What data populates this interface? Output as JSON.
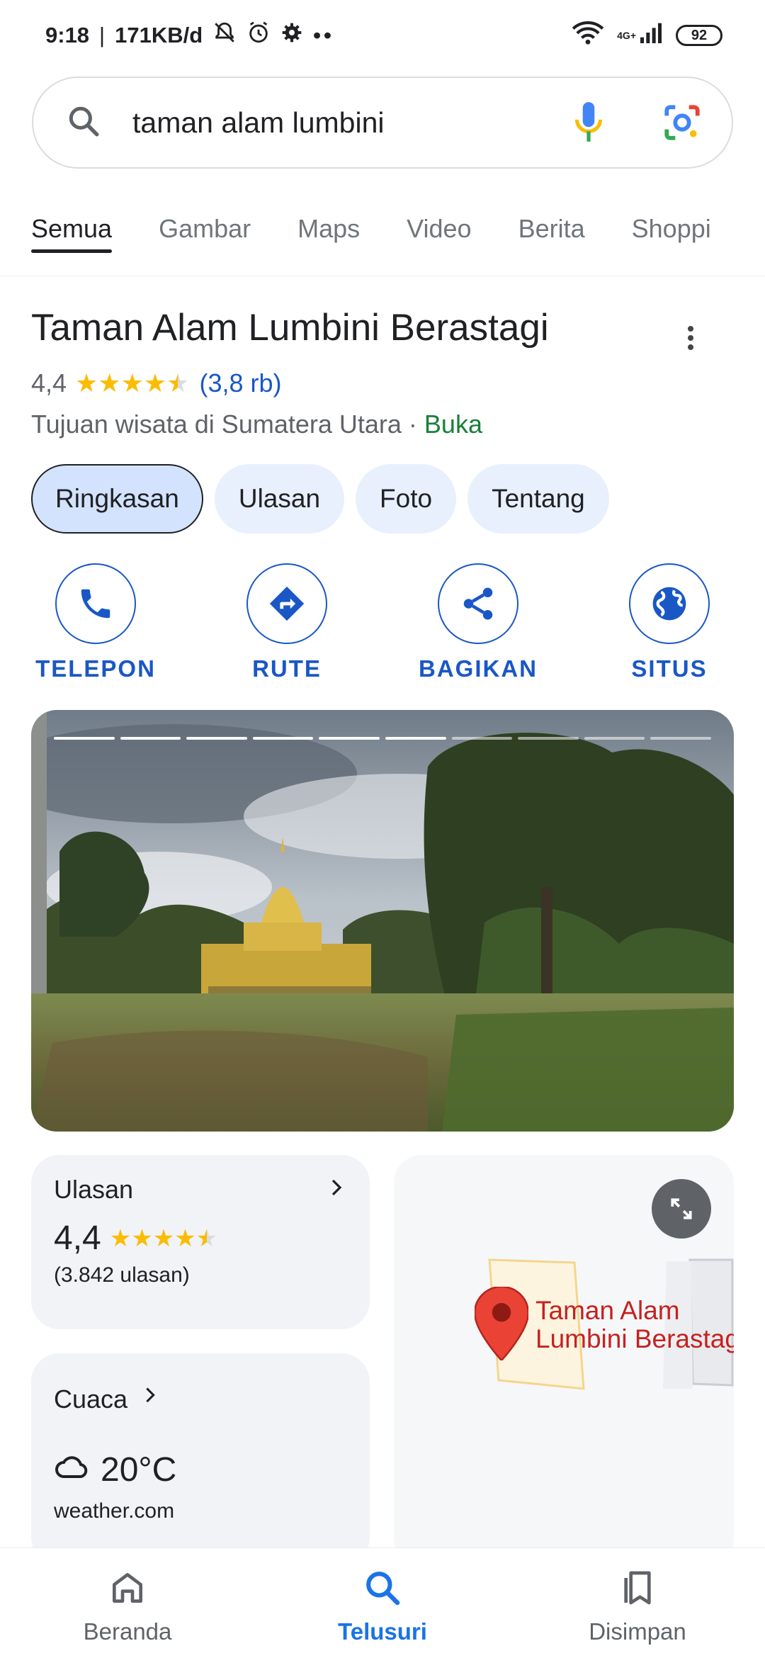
{
  "status_bar": {
    "time": "9:18",
    "speed": "171KB/d",
    "network_label": "4G+",
    "battery": "92",
    "icons": [
      "mute-bell-icon",
      "alarm-icon",
      "gear-icon",
      "more-dots-icon",
      "wifi-icon",
      "signal-icon"
    ]
  },
  "search": {
    "query": "taman alam lumbini",
    "icons": [
      "search-icon",
      "mic-icon",
      "lens-icon"
    ]
  },
  "tabs": [
    "Semua",
    "Gambar",
    "Maps",
    "Video",
    "Berita",
    "Shoppi"
  ],
  "active_tab": "Semua",
  "place": {
    "title": "Taman Alam Lumbini Berastagi",
    "rating": "4,4",
    "rating_value": 4.4,
    "review_count": "(3,8 rb)",
    "category": "Tujuan wisata di Sumatera Utara",
    "separator": " · ",
    "status": "Buka",
    "status_color": "#188038"
  },
  "chips": [
    "Ringkasan",
    "Ulasan",
    "Foto",
    "Tentang"
  ],
  "actions": [
    {
      "label": "TELEPON",
      "icon": "phone-icon"
    },
    {
      "label": "RUTE",
      "icon": "directions-icon"
    },
    {
      "label": "BAGIKAN",
      "icon": "share-icon"
    },
    {
      "label": "SITUS",
      "icon": "globe-icon"
    }
  ],
  "photo": {
    "segments_total": 10,
    "segments_done": 6
  },
  "reviews_card": {
    "heading": "Ulasan",
    "rating": "4,4",
    "count": "(3.842 ulasan)"
  },
  "weather_card": {
    "heading": "Cuaca",
    "temp": "20°C",
    "source": "weather.com",
    "icon": "cloud-icon"
  },
  "map_card": {
    "label_line1": "Taman Alam",
    "label_line2": "Lumbini Berastagi",
    "pin_color": "#ea4335"
  },
  "bottom_nav": [
    {
      "label": "Beranda",
      "icon": "home-icon"
    },
    {
      "label": "Telusuri",
      "icon": "search-icon"
    },
    {
      "label": "Disimpan",
      "icon": "bookmarks-icon"
    }
  ],
  "colors": {
    "accent": "#1a57c6",
    "nav_active": "#1a73e8",
    "star": "#fbbc04"
  }
}
